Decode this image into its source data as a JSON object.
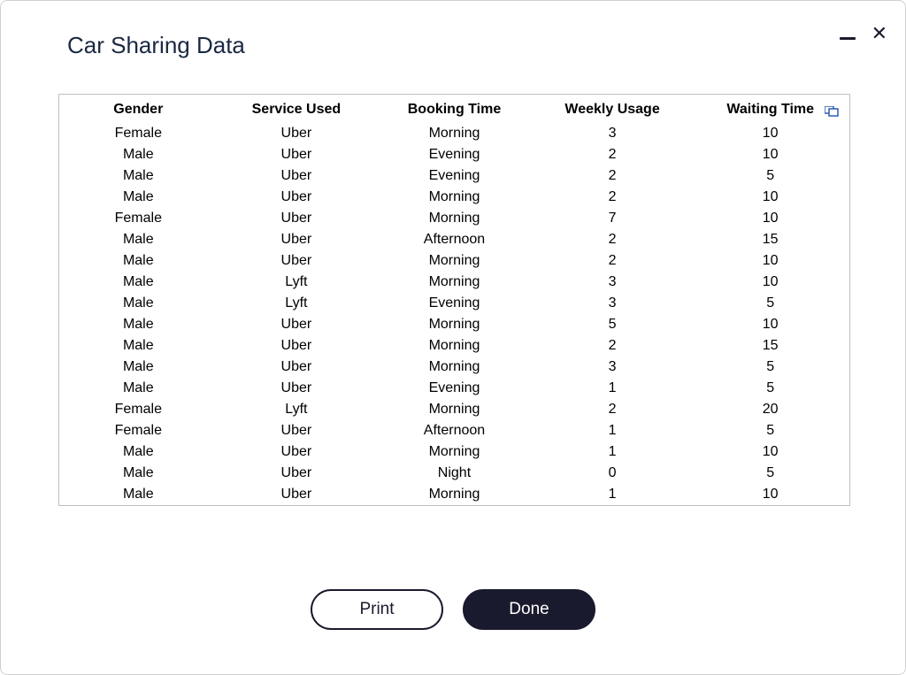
{
  "window": {
    "title": "Car Sharing Data"
  },
  "table": {
    "headers": {
      "gender": "Gender",
      "service": "Service Used",
      "booking": "Booking Time",
      "weekly": "Weekly Usage",
      "waiting": "Waiting Time"
    },
    "rows": [
      {
        "gender": "Female",
        "service": "Uber",
        "booking": "Morning",
        "weekly": "3",
        "waiting": "10"
      },
      {
        "gender": "Male",
        "service": "Uber",
        "booking": "Evening",
        "weekly": "2",
        "waiting": "10"
      },
      {
        "gender": "Male",
        "service": "Uber",
        "booking": "Evening",
        "weekly": "2",
        "waiting": "5"
      },
      {
        "gender": "Male",
        "service": "Uber",
        "booking": "Morning",
        "weekly": "2",
        "waiting": "10"
      },
      {
        "gender": "Female",
        "service": "Uber",
        "booking": "Morning",
        "weekly": "7",
        "waiting": "10"
      },
      {
        "gender": "Male",
        "service": "Uber",
        "booking": "Afternoon",
        "weekly": "2",
        "waiting": "15"
      },
      {
        "gender": "Male",
        "service": "Uber",
        "booking": "Morning",
        "weekly": "2",
        "waiting": "10"
      },
      {
        "gender": "Male",
        "service": "Lyft",
        "booking": "Morning",
        "weekly": "3",
        "waiting": "10"
      },
      {
        "gender": "Male",
        "service": "Lyft",
        "booking": "Evening",
        "weekly": "3",
        "waiting": "5"
      },
      {
        "gender": "Male",
        "service": "Uber",
        "booking": "Morning",
        "weekly": "5",
        "waiting": "10"
      },
      {
        "gender": "Male",
        "service": "Uber",
        "booking": "Morning",
        "weekly": "2",
        "waiting": "15"
      },
      {
        "gender": "Male",
        "service": "Uber",
        "booking": "Morning",
        "weekly": "3",
        "waiting": "5"
      },
      {
        "gender": "Male",
        "service": "Uber",
        "booking": "Evening",
        "weekly": "1",
        "waiting": "5"
      },
      {
        "gender": "Female",
        "service": "Lyft",
        "booking": "Morning",
        "weekly": "2",
        "waiting": "20"
      },
      {
        "gender": "Female",
        "service": "Uber",
        "booking": "Afternoon",
        "weekly": "1",
        "waiting": "5"
      },
      {
        "gender": "Male",
        "service": "Uber",
        "booking": "Morning",
        "weekly": "1",
        "waiting": "10"
      },
      {
        "gender": "Male",
        "service": "Uber",
        "booking": "Night",
        "weekly": "0",
        "waiting": "5"
      },
      {
        "gender": "Male",
        "service": "Uber",
        "booking": "Morning",
        "weekly": "1",
        "waiting": "10"
      }
    ]
  },
  "buttons": {
    "print": "Print",
    "done": "Done"
  }
}
